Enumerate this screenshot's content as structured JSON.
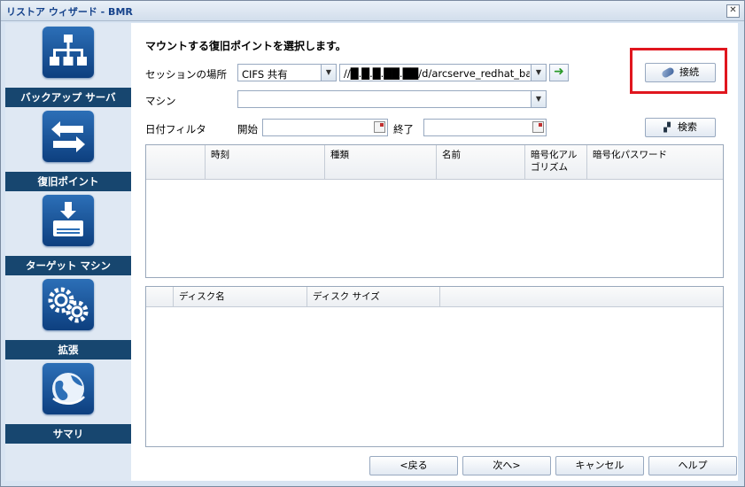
{
  "window": {
    "title": "リストア ウィザード - BMR",
    "close_label": "✕"
  },
  "sidebar": {
    "items": [
      {
        "label": "バックアップ サーバ"
      },
      {
        "label": "復旧ポイント"
      },
      {
        "label": "ターゲット マシン"
      },
      {
        "label": "拡張"
      },
      {
        "label": "サマリ"
      }
    ]
  },
  "main": {
    "heading": "マウントする復旧ポイントを選択します。",
    "session_label": "セッションの場所",
    "session_type": "CIFS 共有",
    "session_path": "//█.█.█.██.██/d/arcserve_redhat_backu",
    "machine_label": "マシン",
    "machine_value": "",
    "date_filter_label": "日付フィルタ",
    "start_label": "開始",
    "end_label": "終了",
    "connect_label": "接続",
    "search_label": "検索",
    "recovery_columns": [
      "",
      "時刻",
      "種類",
      "名前",
      "暗号化アル\nゴリズム",
      "暗号化パスワード"
    ],
    "disk_columns": [
      "",
      "ディスク名",
      "ディスク サイズ",
      ""
    ]
  },
  "footer": {
    "back_label": "<戻る",
    "next_label": "次へ>",
    "cancel_label": "キャンセル",
    "help_label": "ヘルプ"
  },
  "colors": {
    "sidebar_label_bg": "#17466f",
    "highlight": "#e0161e"
  }
}
